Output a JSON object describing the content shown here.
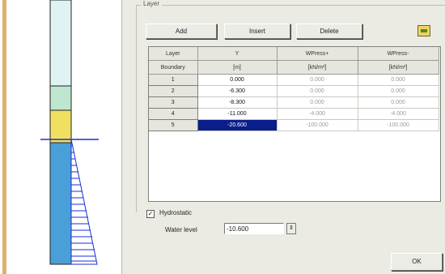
{
  "group": {
    "title": "Layer"
  },
  "toolbar": {
    "add_label": "Add",
    "insert_label": "Insert",
    "delete_label": "Delete",
    "icon": "table-export-icon"
  },
  "table": {
    "headers": [
      [
        "Layer",
        "Boundary"
      ],
      [
        "Y",
        "[m]"
      ],
      [
        "WPress+",
        "[kN/m²]"
      ],
      [
        "WPress-",
        "[kN/m²]"
      ]
    ],
    "rows": [
      {
        "boundary": "1",
        "y": "0.000",
        "wplus": "0.000",
        "wminus": "0.000"
      },
      {
        "boundary": "2",
        "y": "-6.300",
        "wplus": "0.000",
        "wminus": "0.000"
      },
      {
        "boundary": "3",
        "y": "-8.300",
        "wplus": "0.000",
        "wminus": "0.000"
      },
      {
        "boundary": "4",
        "y": "-11.000",
        "wplus": "-4.000",
        "wminus": "-4.000"
      },
      {
        "boundary": "5",
        "y": "-20.600",
        "wplus": "-100.000",
        "wminus": "-100.000"
      }
    ]
  },
  "hydrostatic": {
    "label": "Hydrostatic",
    "checked": "✓"
  },
  "water_level": {
    "label": "Water level",
    "value": "-10.600",
    "spin_icon": "⇕"
  },
  "ok_label": "OK",
  "colors": {
    "layer_top": "#dff3f5",
    "layer_mid": "#bfe6cf",
    "layer_yellow": "#f0e060",
    "layer_bottom": "#4a9fd8",
    "water_line": "#1b2fd0",
    "selection": "#0a1f8c"
  }
}
